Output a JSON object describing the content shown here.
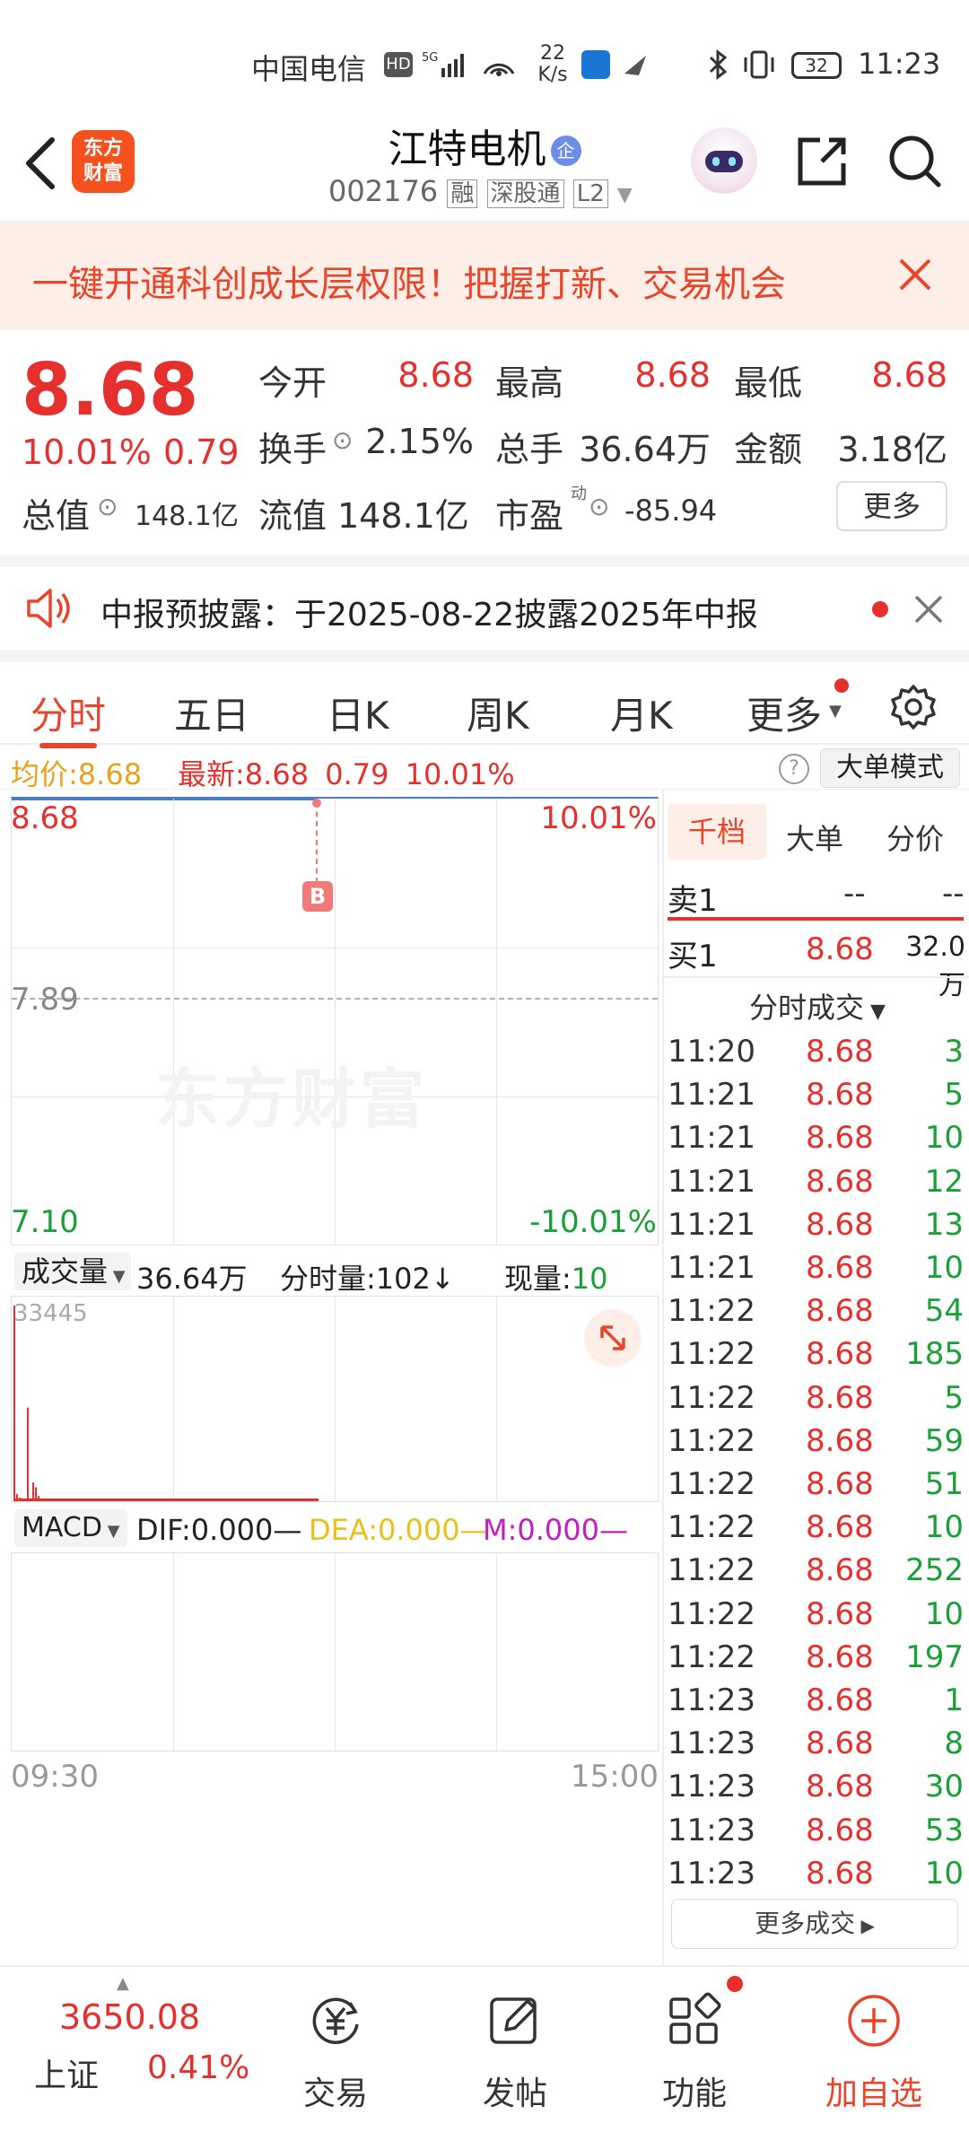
{
  "status_bar": {
    "carrier": "中国电信",
    "net_speed_value": "22",
    "net_speed_unit": "K/s",
    "battery": "32",
    "time": "11:23"
  },
  "header": {
    "logo_text": "东方财富",
    "stock_name": "江特电机",
    "stock_code": "002176",
    "badge_rong": "融",
    "badge_shengu": "深股通",
    "badge_l2": "L2",
    "corp_badge": "企"
  },
  "banner": {
    "text": "一键开通科创成长层权限！把握打新、交易机会"
  },
  "quote": {
    "price": "8.68",
    "change_pct": "10.01%",
    "change": "0.79",
    "open_label": "今开",
    "open": "8.68",
    "high_label": "最高",
    "high": "8.68",
    "low_label": "最低",
    "low": "8.68",
    "turnover_label": "换手",
    "turnover": "2.15%",
    "volume_label": "总手",
    "volume": "36.64万",
    "amount_label": "金额",
    "amount": "3.18亿",
    "market_cap_label": "总值",
    "market_cap": "148.1亿",
    "float_cap_label": "流值",
    "float_cap": "148.1亿",
    "pe_label": "市盈",
    "pe_sup": "动",
    "pe": "-85.94",
    "more_button": "更多"
  },
  "notice": {
    "text": "中报预披露：于2025-08-22披露2025年中报"
  },
  "tabs": [
    "分时",
    "五日",
    "日K",
    "周K",
    "月K",
    "更多"
  ],
  "info_bar": {
    "avg_label": "均价:",
    "avg": "8.68",
    "latest_label": "最新:",
    "latest": "8.68",
    "change": "0.79",
    "pct": "10.01%",
    "help": "?",
    "big_order_mode": "大单模式"
  },
  "chart": {
    "top_price": "8.68",
    "top_pct": "10.01%",
    "mid_price": "7.89",
    "bottom_price": "7.10",
    "bottom_pct": "-10.01%",
    "marker": "B",
    "watermark": "东方财富",
    "vol_selector": "成交量",
    "vol_total": "36.64万",
    "vol_period_label": "分时量:",
    "vol_period": "102",
    "vol_period_arrow": "↓",
    "vol_now_label": "现量:",
    "vol_now": "10",
    "vol_max": "33445",
    "macd_selector": "MACD",
    "dif": "DIF:0.000",
    "dea": "DEA:0.000",
    "m": "M:0.000",
    "time_start": "09:30",
    "time_end": "15:00"
  },
  "chart_data": {
    "type": "line",
    "series": [
      {
        "name": "均价",
        "values": [
          8.68,
          8.68
        ]
      },
      {
        "name": "最新",
        "values": [
          8.68,
          8.68
        ]
      }
    ],
    "x": [
      "09:30",
      "11:23"
    ],
    "xlim": [
      "09:30",
      "15:00"
    ],
    "ylim": [
      7.1,
      8.68
    ],
    "volume_bars": [
      33445,
      1200,
      600,
      300,
      200,
      16000,
      500,
      3200,
      2400,
      900,
      400,
      300,
      200,
      150,
      120,
      100,
      90,
      80,
      70,
      60
    ],
    "volume_max": 33445
  },
  "order_book": {
    "tabs": [
      "千档",
      "大单",
      "分价"
    ],
    "sell1_label": "卖1",
    "sell1_price": "--",
    "sell1_vol": "--",
    "buy1_label": "买1",
    "buy1_price": "8.68",
    "buy1_vol": "32.0万",
    "ticks_title": "分时成交",
    "ticks": [
      {
        "time": "11:20",
        "price": "8.68",
        "vol": "3"
      },
      {
        "time": "11:21",
        "price": "8.68",
        "vol": "5"
      },
      {
        "time": "11:21",
        "price": "8.68",
        "vol": "10"
      },
      {
        "time": "11:21",
        "price": "8.68",
        "vol": "12"
      },
      {
        "time": "11:21",
        "price": "8.68",
        "vol": "13"
      },
      {
        "time": "11:21",
        "price": "8.68",
        "vol": "10"
      },
      {
        "time": "11:22",
        "price": "8.68",
        "vol": "54"
      },
      {
        "time": "11:22",
        "price": "8.68",
        "vol": "185"
      },
      {
        "time": "11:22",
        "price": "8.68",
        "vol": "5"
      },
      {
        "time": "11:22",
        "price": "8.68",
        "vol": "59"
      },
      {
        "time": "11:22",
        "price": "8.68",
        "vol": "51"
      },
      {
        "time": "11:22",
        "price": "8.68",
        "vol": "10"
      },
      {
        "time": "11:22",
        "price": "8.68",
        "vol": "252"
      },
      {
        "time": "11:22",
        "price": "8.68",
        "vol": "10"
      },
      {
        "time": "11:22",
        "price": "8.68",
        "vol": "197"
      },
      {
        "time": "11:23",
        "price": "8.68",
        "vol": "1"
      },
      {
        "time": "11:23",
        "price": "8.68",
        "vol": "8"
      },
      {
        "time": "11:23",
        "price": "8.68",
        "vol": "30"
      },
      {
        "time": "11:23",
        "price": "8.68",
        "vol": "53"
      },
      {
        "time": "11:23",
        "price": "8.68",
        "vol": "10"
      }
    ],
    "more_ticks": "更多成交"
  },
  "bottom_nav": {
    "index_value": "3650.08",
    "index_name": "上证",
    "index_pct": "0.41%",
    "items": [
      "交易",
      "发帖",
      "功能",
      "加自选"
    ]
  },
  "colors": {
    "up": "#e5302d",
    "down": "#1aa038",
    "brand": "#f4511e",
    "avg_line": "#e8a21c"
  }
}
